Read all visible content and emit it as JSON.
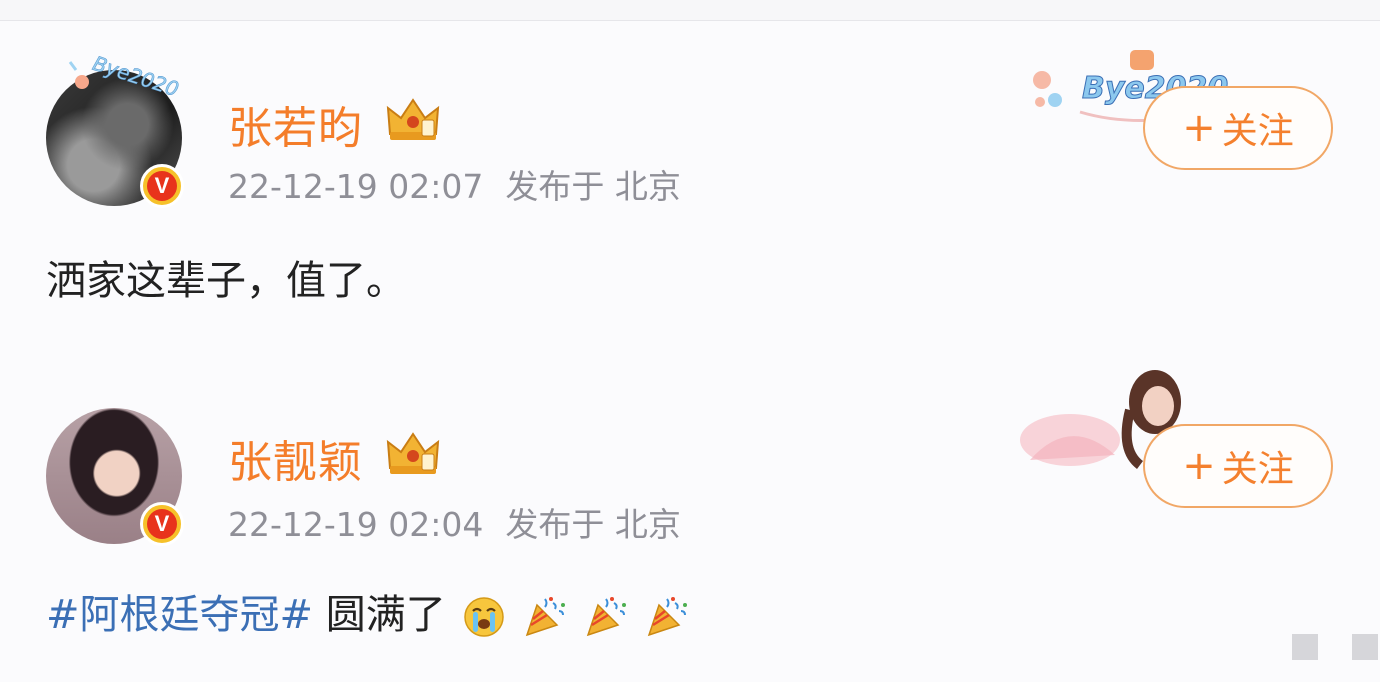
{
  "posts": [
    {
      "username": "张若昀",
      "timestamp": "22-12-19 02:07",
      "location_prefix": "发布于",
      "location": "北京",
      "content": "洒家这辈子，值了。",
      "follow_plus": "+",
      "follow_label": "关注",
      "avatar_frame_text": "Bye2020",
      "deco_text": "Bye2020"
    },
    {
      "username": "张靓颖",
      "timestamp": "22-12-19 02:04",
      "location_prefix": "发布于",
      "location": "北京",
      "hashtag": "#阿根廷夺冠#",
      "content": "圆满了",
      "follow_plus": "+",
      "follow_label": "关注"
    }
  ],
  "icons": {
    "verified": "V",
    "crown": "crown-icon",
    "crying": "loudly-crying-face-emoji",
    "party": "party-popper-emoji"
  },
  "colors": {
    "username": "#f47d2a",
    "meta": "#8f8f97",
    "hashtag": "#3b6fb5",
    "follow_border": "#f1a766",
    "verified": "#e8331c"
  }
}
